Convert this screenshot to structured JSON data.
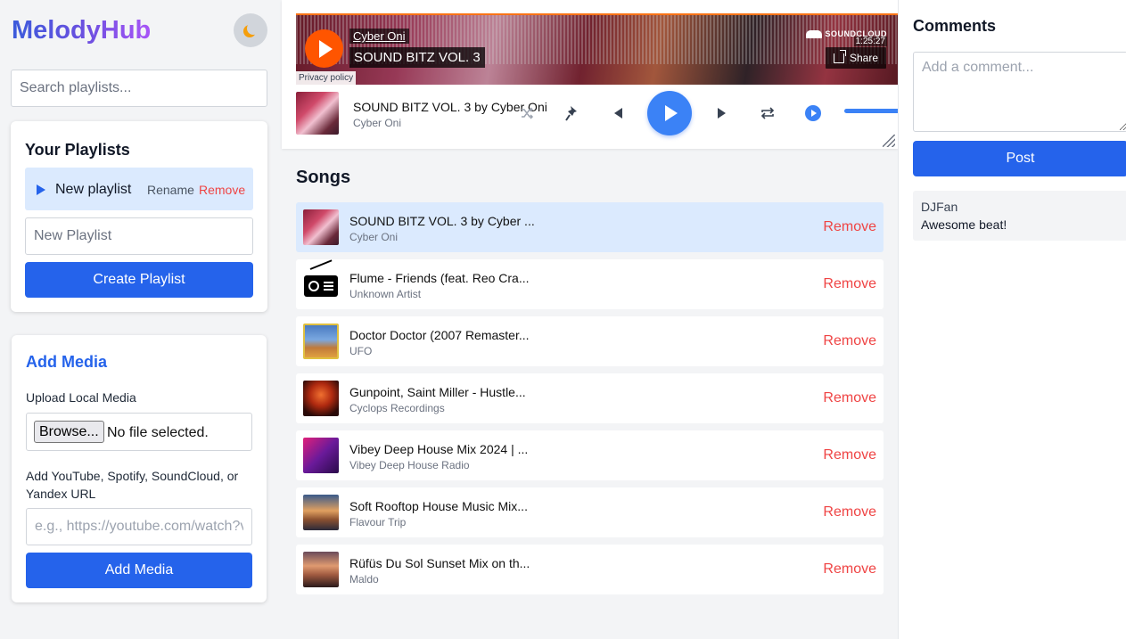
{
  "app": {
    "title": "MelodyHub",
    "theme_toggle_icon": "moon-icon"
  },
  "search": {
    "placeholder": "Search playlists..."
  },
  "playlists": {
    "heading": "Your Playlists",
    "items": [
      {
        "name": "New playlist",
        "rename_label": "Rename",
        "remove_label": "Remove",
        "active": true
      }
    ],
    "new_placeholder": "New Playlist",
    "create_label": "Create Playlist"
  },
  "add_media": {
    "heading": "Add Media",
    "upload_label": "Upload Local Media",
    "browse_label": "Browse...",
    "file_status": "No file selected.",
    "url_label": "Add YouTube, Spotify, SoundCloud, or Yandex URL",
    "url_placeholder": "e.g., https://youtube.com/watch?v=...",
    "submit_label": "Add Media"
  },
  "embed": {
    "artist": "Cyber Oni",
    "title": "SOUND BITZ VOL. 3",
    "brand": "SOUNDCLOUD",
    "duration": "1:25:27",
    "share_label": "Share",
    "privacy_label": "Privacy policy"
  },
  "now_playing": {
    "title": "SOUND BITZ VOL. 3 by Cyber Oni",
    "artist": "Cyber Oni",
    "volume": 1.0,
    "controls": [
      "shuffle-icon",
      "pin-icon",
      "previous-icon",
      "play-icon",
      "next-icon",
      "repeat-icon",
      "volume-icon"
    ]
  },
  "songs": {
    "heading": "Songs",
    "remove_label": "Remove",
    "items": [
      {
        "title": "SOUND BITZ VOL. 3 by Cyber ...",
        "artist": "Cyber Oni",
        "active": true
      },
      {
        "title": "Flume - Friends (feat. Reo Cra...",
        "artist": "Unknown Artist",
        "active": false
      },
      {
        "title": "Doctor Doctor (2007 Remaster...",
        "artist": "UFO",
        "active": false
      },
      {
        "title": "Gunpoint, Saint Miller - Hustle...",
        "artist": "Cyclops Recordings",
        "active": false
      },
      {
        "title": "Vibey Deep House Mix 2024 | ...",
        "artist": "Vibey Deep House Radio",
        "active": false
      },
      {
        "title": "Soft Rooftop House Music Mix...",
        "artist": "Flavour Trip",
        "active": false
      },
      {
        "title": "Rüfüs Du Sol Sunset Mix on th...",
        "artist": "Maldo",
        "active": false
      }
    ]
  },
  "comments": {
    "heading": "Comments",
    "placeholder": "Add a comment...",
    "post_label": "Post",
    "items": [
      {
        "user": "DJFan",
        "text": "Awesome beat!"
      }
    ]
  },
  "colors": {
    "accent": "#2563eb",
    "danger": "#ef4444",
    "active_row": "#dbeafe"
  }
}
